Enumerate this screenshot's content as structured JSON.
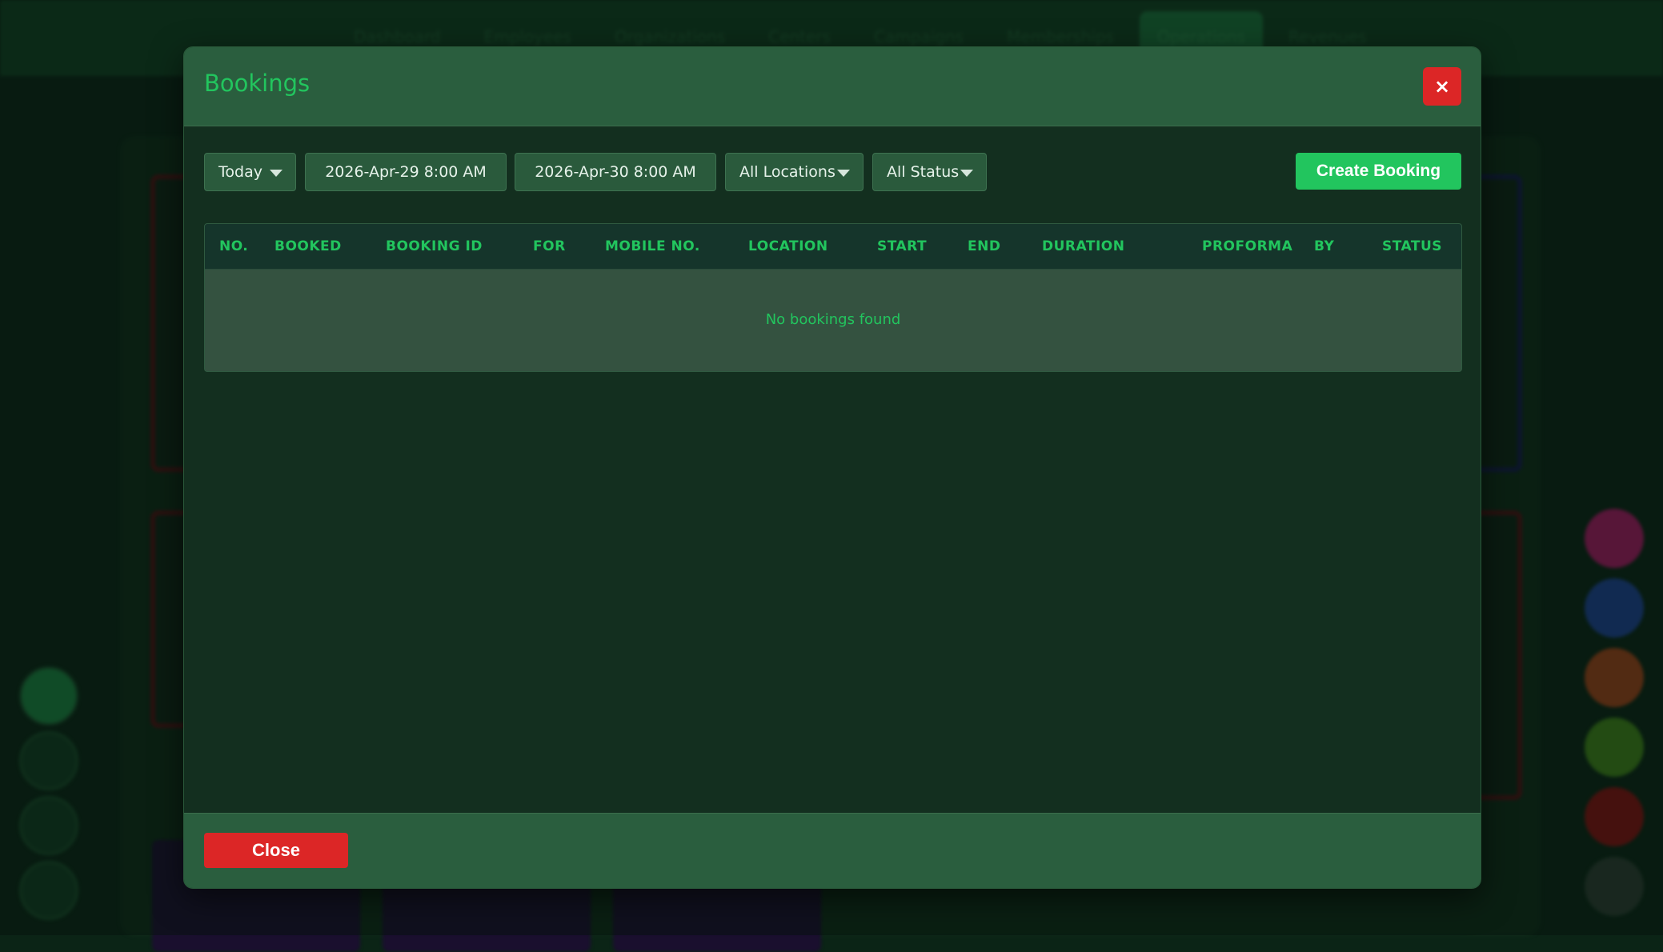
{
  "background": {
    "nav": [
      "Dashboard",
      "Employees",
      "Organizations",
      "Centers",
      "Campaigns",
      "Memberships",
      "Operations",
      "Revenues"
    ],
    "active_nav": "Operations"
  },
  "modal": {
    "title": "Bookings",
    "close_icon": "×",
    "filters": {
      "period": "Today",
      "start_datetime": "2026-Apr-29 8:00 AM",
      "end_datetime": "2026-Apr-30 8:00 AM",
      "location": "All Locations",
      "status": "All Status"
    },
    "create_label": "Create Booking",
    "table": {
      "columns": [
        "NO.",
        "BOOKED",
        "BOOKING ID",
        "FOR",
        "MOBILE NO.",
        "LOCATION",
        "START",
        "END",
        "DURATION",
        "PROFORMA",
        "BY",
        "STATUS"
      ],
      "empty_message": "No bookings found"
    },
    "footer_close_label": "Close"
  },
  "colors": {
    "accent": "#22c55e",
    "danger": "#dc2626",
    "header_bg": "#2a5e3e",
    "body_bg": "#132f1f"
  },
  "icons": {
    "close": "close-icon",
    "dropdown": "chevron-down-icon"
  }
}
